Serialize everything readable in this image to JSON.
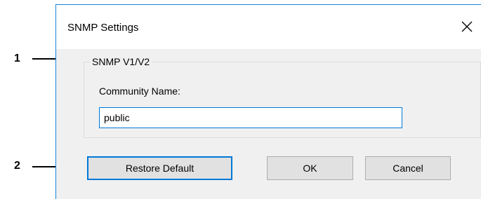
{
  "callouts": {
    "one": "1",
    "two": "2"
  },
  "dialog": {
    "title": "SNMP Settings",
    "close_icon": "close-icon",
    "group": {
      "legend": "SNMP V1/V2",
      "community_label": "Community Name:",
      "community_value": "public"
    },
    "buttons": {
      "restore": "Restore Default",
      "ok": "OK",
      "cancel": "Cancel"
    }
  },
  "colors": {
    "accent": "#0078d7",
    "dialog_background": "#f0f0f0",
    "button_face": "#e1e1e1"
  }
}
